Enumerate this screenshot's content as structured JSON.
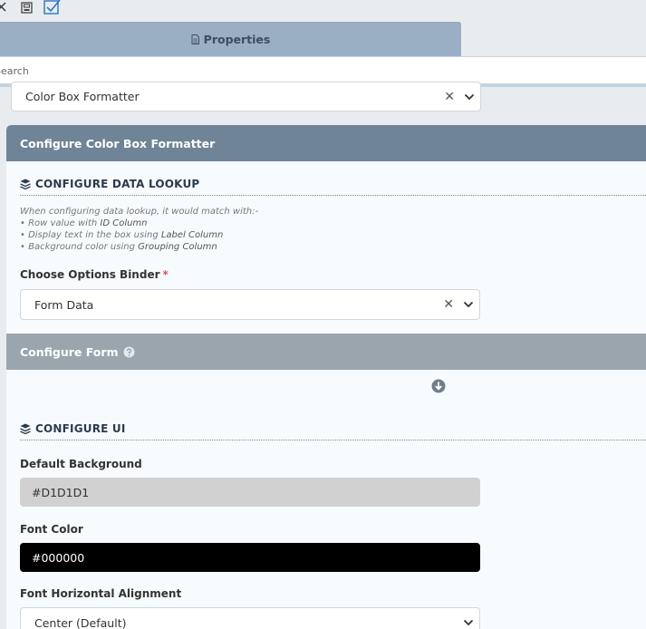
{
  "tab": {
    "label": "Properties"
  },
  "search": {
    "placeholder": "Search"
  },
  "formatter_select": {
    "value": "Color Box Formatter"
  },
  "panel": {
    "title": "Configure Color Box Formatter",
    "lookup": {
      "title": "CONFIGURE DATA LOOKUP",
      "hint_intro": "When configuring data lookup, it would match with:-",
      "hint_lines": [
        {
          "prefix": "• Row value with ",
          "bold": "ID Column"
        },
        {
          "prefix": "• Display text in the box using ",
          "bold": "Label Column"
        },
        {
          "prefix": "• Background color using ",
          "bold": "Grouping Column"
        }
      ],
      "binder_label": "Choose Options Binder",
      "binder_required": "*",
      "binder_value": "Form Data"
    },
    "configure_form": {
      "title": "Configure Form"
    },
    "ui": {
      "title": "CONFIGURE UI",
      "default_background_label": "Default Background",
      "default_background_value": "#D1D1D1",
      "default_background_color": "#D1D1D1",
      "font_color_label": "Font Color",
      "font_color_value": "#000000",
      "font_color_color": "#000000",
      "alignment_label": "Font Horizontal Alignment",
      "alignment_value": "Center (Default)"
    }
  },
  "icons": [
    "close-icon",
    "save-icon",
    "checkbox-icon",
    "document-icon",
    "layers-icon",
    "question-circle-icon",
    "arrow-down-circle-icon",
    "chevron-down-icon"
  ]
}
